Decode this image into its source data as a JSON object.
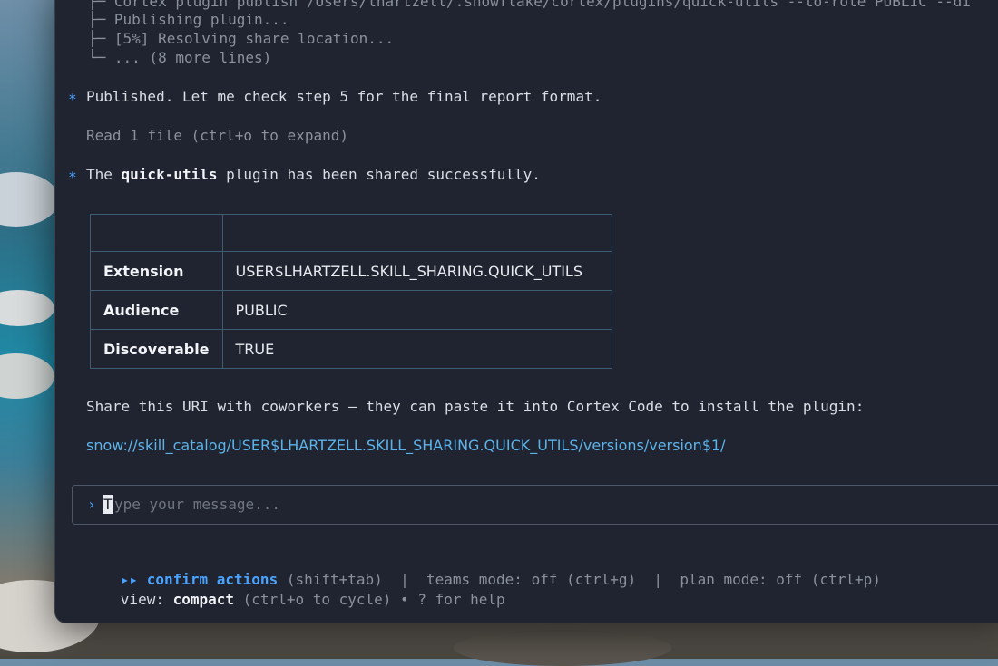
{
  "terminal": {
    "log_lines": [
      "├─ Cortex plugin publish /Users/lhartzell/.snowflake/cortex/plugins/quick-utils --to-role PUBLIC --di",
      "├─ Publishing plugin...",
      "├─ [5%] Resolving share location...",
      "└─ ... (8 more lines)"
    ],
    "bullet_glyph": "∗",
    "msg_published": "Published. Let me check step 5 for the final report format.",
    "read_file": "Read 1 file (ctrl+o to expand)",
    "msg_shared": {
      "prefix": "The ",
      "plugin_name": "quick-utils",
      "suffix": " plugin has been shared successfully."
    },
    "table": {
      "rows": [
        {
          "key": "Extension",
          "value": "USER$LHARTZELL.SKILL_SHARING.QUICK_UTILS"
        },
        {
          "key": "Audience",
          "value": "PUBLIC"
        },
        {
          "key": "Discoverable",
          "value": "TRUE"
        }
      ]
    },
    "share_text": "Share this URI with coworkers — they can paste it into Cortex Code to install the plugin:",
    "share_uri": "snow://skill_catalog/USER$LHARTZELL.SKILL_SHARING.QUICK_UTILS/versions/version$1/"
  },
  "input": {
    "prompt_glyph": "›",
    "cursor_char": "T",
    "placeholder_rest": "ype your message..."
  },
  "footer": {
    "arrows": "▸▸",
    "confirm_label": "confirm actions",
    "confirm_key": " (shift+tab)",
    "sep1": "  |  ",
    "teams": "teams mode: off (ctrl+g)",
    "sep2": "  |  ",
    "plan": "plan mode: off (ctrl+p)",
    "view_label": "view: ",
    "view_value": "compact",
    "view_hint": " (ctrl+o to cycle) • ? for help"
  },
  "colors": {
    "accent": "#4aa3ff",
    "link": "#5cb3ea",
    "terminal_bg": "#1f2430"
  }
}
